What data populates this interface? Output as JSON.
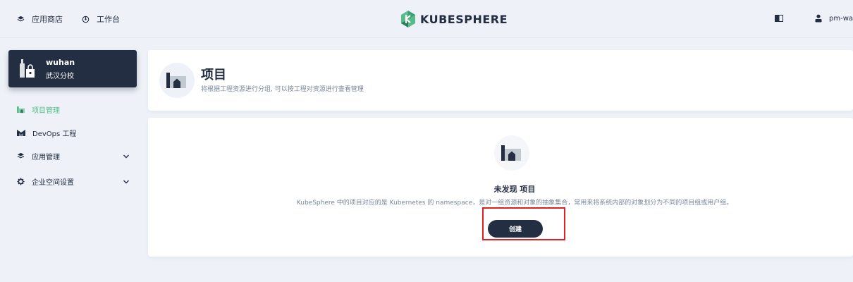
{
  "header": {
    "nav": [
      {
        "label": "应用商店",
        "icon": "stack-icon"
      },
      {
        "label": "工作台",
        "icon": "dashboard-icon"
      }
    ],
    "logo_text": "KUBESPHERE",
    "user_name": "pm-war",
    "colors": {
      "brand": "#55bc8a",
      "dark": "#242e42"
    }
  },
  "workspace": {
    "name": "wuhan",
    "description": "武汉分校"
  },
  "sidebar": {
    "items": [
      {
        "label": "项目管理",
        "icon": "project-icon",
        "active": true
      },
      {
        "label": "DevOps 工程",
        "icon": "devops-icon",
        "active": false
      },
      {
        "label": "应用管理",
        "icon": "stack-icon",
        "active": false,
        "expandable": true
      },
      {
        "label": "企业空间设置",
        "icon": "gear-icon",
        "active": false,
        "expandable": true
      }
    ]
  },
  "banner": {
    "title": "项目",
    "description": "将根据工程资源进行分组, 可以按工程对资源进行查看管理"
  },
  "empty_state": {
    "title": "未发现 项目",
    "description": "KubeSphere 中的项目对应的是 Kubernetes 的 namespace，是对一组资源和对象的抽象集合，常用来将系统内部的对象划分为不同的项目组或用户组。",
    "create_label": "创建"
  }
}
